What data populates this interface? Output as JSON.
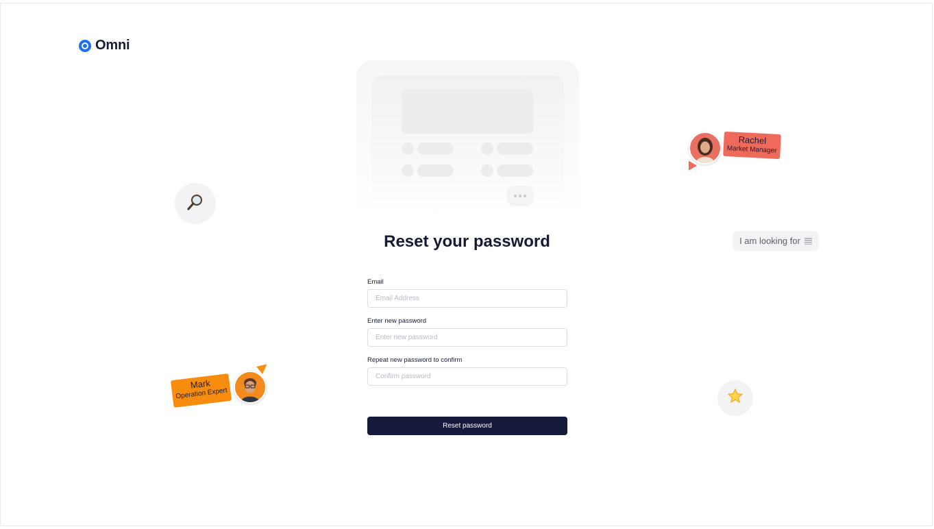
{
  "brand": {
    "name": "Omni",
    "color": "#1d6ff2"
  },
  "page": {
    "title": "Reset your password"
  },
  "form": {
    "email": {
      "label": "Email",
      "placeholder": "Email Address",
      "value": ""
    },
    "new_password": {
      "label": "Enter new password",
      "placeholder": "Enter new password",
      "value": ""
    },
    "confirm_password": {
      "label": "Repeat new password to confirm",
      "placeholder": "Confirm password",
      "value": ""
    },
    "submit_label": "Reset password"
  },
  "decorations": {
    "search_icon": "magnifying-glass-icon",
    "star_icon": "star-icon",
    "looking_for_text": "I am looking for",
    "people": [
      {
        "name": "Rachel",
        "role": "Market Manager",
        "color": "#f06a5c"
      },
      {
        "name": "Mark",
        "role": "Operation Expert",
        "color": "#f78c0f"
      }
    ]
  },
  "colors": {
    "primary_button": "#161a3a",
    "title": "#161a33"
  }
}
